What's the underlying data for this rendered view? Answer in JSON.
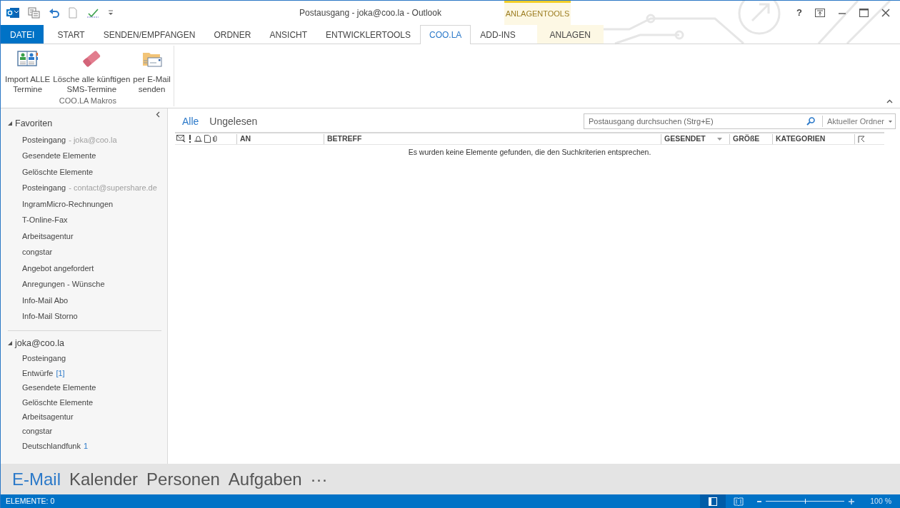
{
  "window": {
    "title": "Postausgang - joka@coo.la - Outlook",
    "help": "?"
  },
  "context_group": {
    "label": "ANLAGENTOOLS"
  },
  "tabs": [
    {
      "label": "DATEI",
      "kind": "file",
      "selected": false
    },
    {
      "label": "START",
      "kind": "tab",
      "selected": false
    },
    {
      "label": "SENDEN/EMPFANGEN",
      "kind": "tab",
      "selected": false
    },
    {
      "label": "ORDNER",
      "kind": "tab",
      "selected": false
    },
    {
      "label": "ANSICHT",
      "kind": "tab",
      "selected": false
    },
    {
      "label": "ENTWICKLERTOOLS",
      "kind": "tab",
      "selected": false
    },
    {
      "label": "COO.LA",
      "kind": "tab",
      "selected": true
    },
    {
      "label": "ADD-INS",
      "kind": "tab",
      "selected": false
    },
    {
      "label": "ANLAGEN",
      "kind": "context",
      "selected": false
    }
  ],
  "ribbon": {
    "group": "COO.LA Makros",
    "buttons": [
      {
        "lines": [
          "Import ALLE",
          "Termine"
        ],
        "kind": "book"
      },
      {
        "lines": [
          "Lösche alle künftigen",
          "SMS-Termine"
        ],
        "kind": "eraser"
      },
      {
        "lines": [
          "per E-Mail",
          "senden"
        ],
        "kind": "mail"
      }
    ]
  },
  "sidebar": {
    "sections": [
      {
        "label": "Favoriten",
        "expanded": true,
        "items": [
          {
            "label": "Posteingang",
            "account": "- joka@coo.la"
          },
          {
            "label": "Gesendete Elemente"
          },
          {
            "label": "Gelöschte Elemente"
          },
          {
            "label": "Posteingang",
            "account": "- contact@supershare.de"
          },
          {
            "label": "IngramMicro-Rechnungen"
          },
          {
            "label": "T-Online-Fax"
          },
          {
            "label": "Arbeitsagentur"
          },
          {
            "label": "congstar"
          },
          {
            "label": "Angebot angefordert"
          },
          {
            "label": "Anregungen - Wünsche"
          },
          {
            "label": "Info-Mail Abo"
          },
          {
            "label": "Info-Mail Storno"
          }
        ]
      },
      {
        "label": "joka@coo.la",
        "expanded": true,
        "items": [
          {
            "label": "Posteingang"
          },
          {
            "label": "Entwürfe",
            "count": "[1]"
          },
          {
            "label": "Gesendete Elemente"
          },
          {
            "label": "Gelöschte Elemente"
          },
          {
            "label": "Arbeitsagentur"
          },
          {
            "label": "congstar"
          },
          {
            "label": "Deutschlandfunk",
            "count": "1"
          }
        ]
      }
    ]
  },
  "filters": [
    {
      "label": "Alle",
      "selected": true
    },
    {
      "label": "Ungelesen",
      "selected": false
    }
  ],
  "search": {
    "placeholder": "Postausgang durchsuchen (Strg+E)",
    "scope": "Aktueller Ordner"
  },
  "table": {
    "columns": [
      {
        "label": "AN",
        "kind": "text"
      },
      {
        "label": "BETREFF",
        "kind": "text"
      },
      {
        "label": "GESENDET",
        "kind": "sorted"
      },
      {
        "label": "GRÖßE",
        "kind": "text"
      },
      {
        "label": "KATEGORIEN",
        "kind": "text"
      }
    ],
    "empty_message": "Es wurden keine Elemente gefunden, die den Suchkriterien entsprechen."
  },
  "nav": [
    {
      "label": "E-Mail",
      "selected": true
    },
    {
      "label": "Kalender",
      "selected": false
    },
    {
      "label": "Personen",
      "selected": false
    },
    {
      "label": "Aufgaben",
      "selected": false
    },
    {
      "label": "···",
      "selected": false
    }
  ],
  "status_bar": {
    "items": "ELEMENTE: 0",
    "zoom": "100 %",
    "level": 0.5
  }
}
